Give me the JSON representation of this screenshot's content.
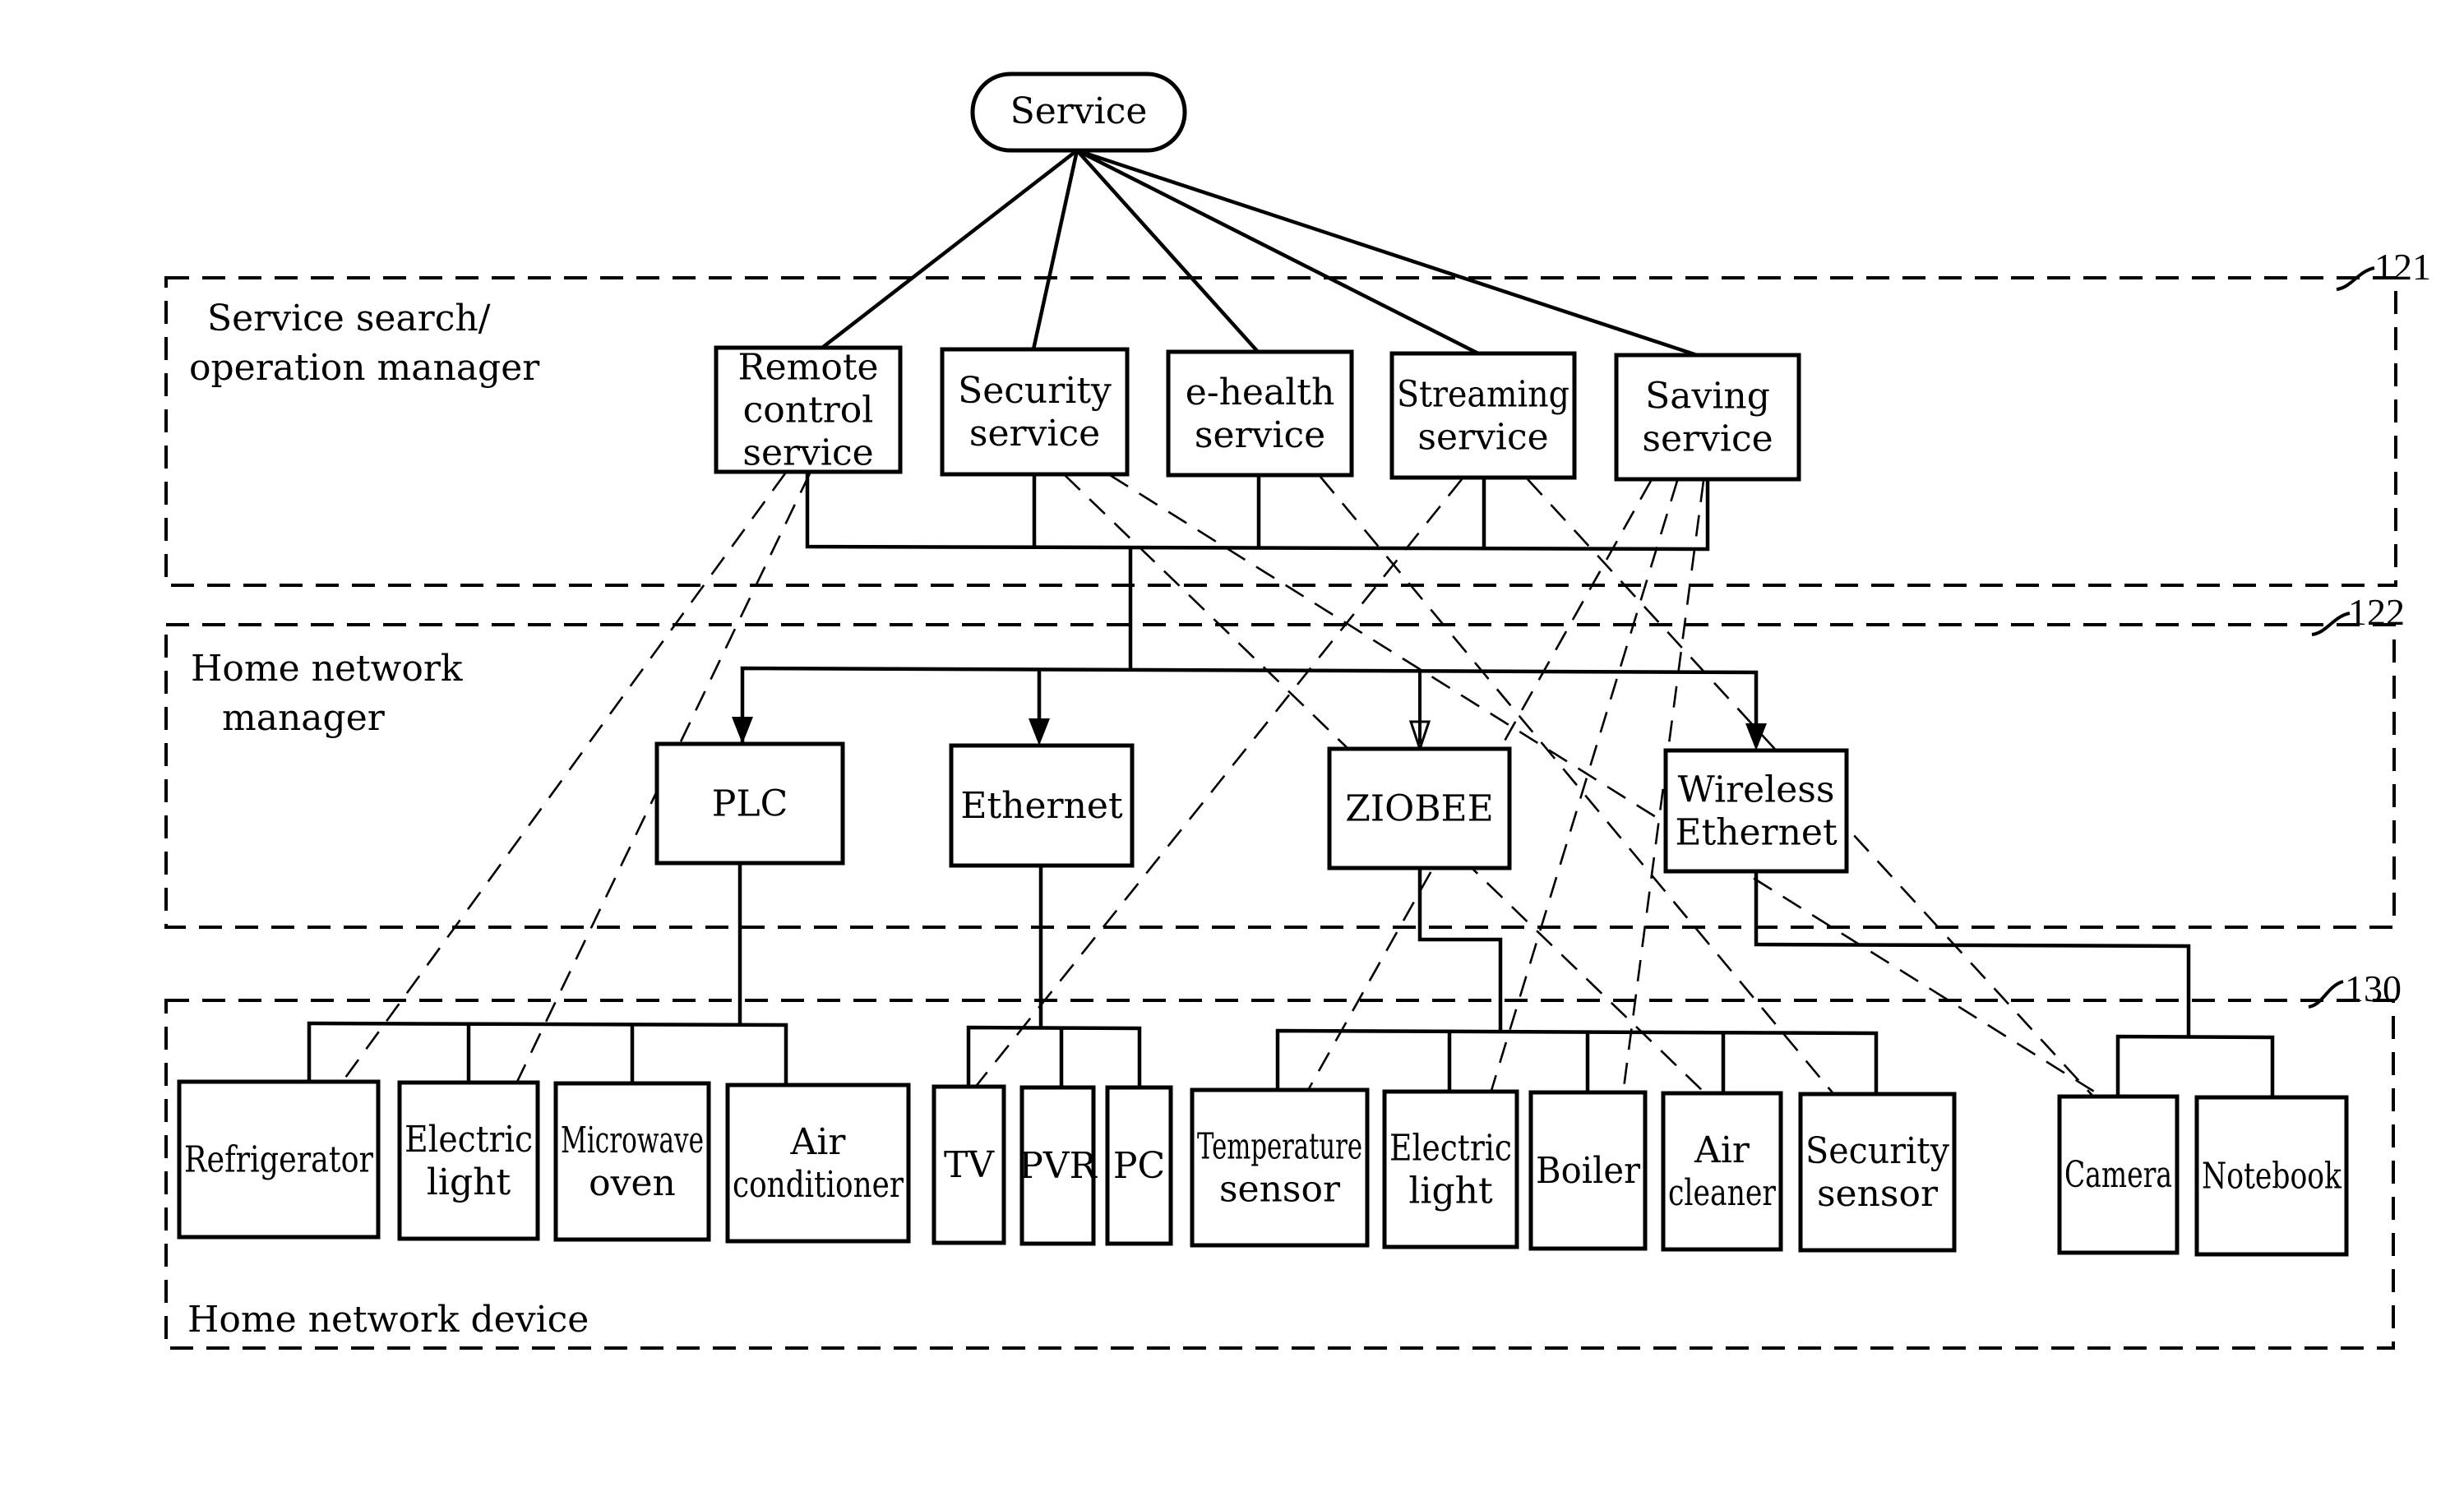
{
  "root": {
    "label": [
      "Service"
    ]
  },
  "regions": [
    {
      "id": "service-manager",
      "ref": "121",
      "label": [
        "Service search/",
        "operation manager"
      ]
    },
    {
      "id": "network-manager",
      "ref": "122",
      "label": [
        "Home network",
        "manager"
      ]
    },
    {
      "id": "network-device",
      "ref": "130",
      "label": [
        "Home network device"
      ]
    }
  ],
  "services": [
    {
      "id": "remote-control-service",
      "label": [
        "Remote",
        "control",
        "service"
      ]
    },
    {
      "id": "security-service",
      "label": [
        "Security",
        "service"
      ]
    },
    {
      "id": "e-health-service",
      "label": [
        "e-health",
        "service"
      ]
    },
    {
      "id": "streaming-service",
      "label": [
        "Streaming",
        "service"
      ]
    },
    {
      "id": "saving-service",
      "label": [
        "Saving",
        "service"
      ]
    }
  ],
  "networks": [
    {
      "id": "plc",
      "label": [
        "PLC"
      ]
    },
    {
      "id": "ethernet",
      "label": [
        "Ethernet"
      ]
    },
    {
      "id": "ziobee",
      "label": [
        "ZIOBEE"
      ]
    },
    {
      "id": "wireless-ethernet",
      "label": [
        "Wireless",
        "Ethernet"
      ]
    }
  ],
  "devices": [
    {
      "id": "refrigerator",
      "network": "plc",
      "label": [
        "Refrigerator"
      ]
    },
    {
      "id": "electric-light-plc",
      "network": "plc",
      "label": [
        "Electric",
        "light"
      ]
    },
    {
      "id": "microwave-oven",
      "network": "plc",
      "label": [
        "Microwave",
        "oven"
      ]
    },
    {
      "id": "air-conditioner",
      "network": "plc",
      "label": [
        "Air",
        "conditioner"
      ]
    },
    {
      "id": "tv",
      "network": "ethernet",
      "label": [
        "TV"
      ]
    },
    {
      "id": "pvr",
      "network": "ethernet",
      "label": [
        "PVR"
      ]
    },
    {
      "id": "pc",
      "network": "ethernet",
      "label": [
        "PC"
      ]
    },
    {
      "id": "temperature-sensor",
      "network": "ziobee",
      "label": [
        "Temperature",
        "sensor"
      ]
    },
    {
      "id": "electric-light-ziobee",
      "network": "ziobee",
      "label": [
        "Electric",
        "light"
      ]
    },
    {
      "id": "boiler",
      "network": "ziobee",
      "label": [
        "Boiler"
      ]
    },
    {
      "id": "air-cleaner",
      "network": "ziobee",
      "label": [
        "Air",
        "cleaner"
      ]
    },
    {
      "id": "security-sensor",
      "network": "ziobee",
      "label": [
        "Security",
        "sensor"
      ]
    },
    {
      "id": "camera",
      "network": "wireless-ethernet",
      "label": [
        "Camera"
      ]
    },
    {
      "id": "notebook",
      "network": "wireless-ethernet",
      "label": [
        "Notebook"
      ]
    }
  ],
  "service_device_links": [
    {
      "service": "remote-control-service",
      "device": "refrigerator"
    },
    {
      "service": "remote-control-service",
      "device": "electric-light-plc"
    },
    {
      "service": "security-service",
      "device": "air-cleaner"
    },
    {
      "service": "security-service",
      "device": "camera"
    },
    {
      "service": "e-health-service",
      "device": "air-cleaner"
    },
    {
      "service": "streaming-service",
      "device": "tv"
    },
    {
      "service": "streaming-service",
      "device": "camera"
    },
    {
      "service": "saving-service",
      "device": "temperature-sensor"
    },
    {
      "service": "saving-service",
      "device": "electric-light-ziobee"
    },
    {
      "service": "saving-service",
      "device": "boiler"
    }
  ]
}
